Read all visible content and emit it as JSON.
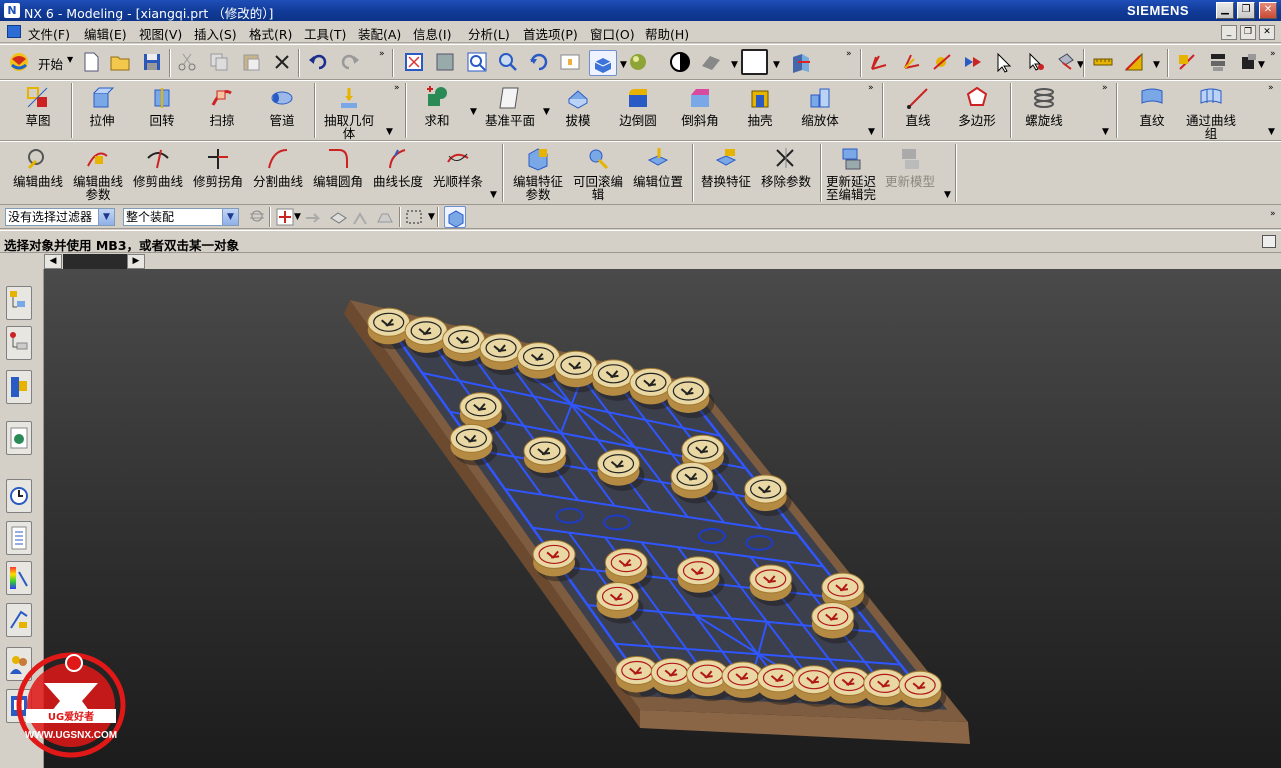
{
  "window": {
    "title": "NX 6 - Modeling - [xiangqi.prt （修改的）]",
    "brand": "SIEMENS",
    "controls": [
      "minimize",
      "maximize",
      "close"
    ]
  },
  "menu": {
    "items": [
      "文件(F)",
      "编辑(E)",
      "视图(V)",
      "插入(S)",
      "格式(R)",
      "工具(T)",
      "装配(A)",
      "信息(I)",
      "分析(L)",
      "首选项(P)",
      "窗口(O)",
      "帮助(H)"
    ]
  },
  "standard_toolbar": {
    "start_label": "开始",
    "icons": [
      "new-file-icon",
      "open-folder-icon",
      "save-icon",
      "cut-icon",
      "copy-icon",
      "paste-icon",
      "delete-icon",
      "undo-icon",
      "redo-icon",
      "fit-icon",
      "zoom-window-icon",
      "zoom-icon",
      "zoom-in-out-icon",
      "rotate-icon",
      "pan-icon",
      "shaded-view-icon",
      "render-style-icon",
      "face-analysis-icon",
      "sheet-icon",
      "background-icon",
      "orient-view-icon",
      "wcs-icon",
      "csys-icon",
      "point-icon",
      "snap-icon",
      "select-icon",
      "filter-icon",
      "measure-distance-icon",
      "measure-angle-icon",
      "assembly-icon",
      "component-icon",
      "constraint-icon"
    ]
  },
  "feature_toolbar": {
    "buttons": [
      "草图",
      "拉伸",
      "回转",
      "扫掠",
      "管道",
      "抽取几何体",
      "求和",
      "基准平面",
      "拔模",
      "边倒圆",
      "倒斜角",
      "抽壳",
      "缩放体",
      "直线",
      "多边形",
      "螺旋线",
      "直纹",
      "通过曲线组"
    ]
  },
  "edit_toolbar": {
    "buttons": [
      "编辑曲线",
      "编辑曲线参数",
      "修剪曲线",
      "修剪拐角",
      "分割曲线",
      "编辑圆角",
      "曲线长度",
      "光顺样条",
      "编辑特征参数",
      "可回滚编辑",
      "编辑位置",
      "替换特征",
      "移除参数",
      "更新延迟至编辑完",
      "更新模型"
    ],
    "disabled": [
      "更新模型"
    ]
  },
  "selection_bar": {
    "filter_value": "没有选择过滤器",
    "scope_value": "整个装配"
  },
  "status": {
    "cue_line": "选择对象并使用 MB3，或者双击某一对象"
  },
  "resource_bar": {
    "tabs": [
      "assembly-navigator-icon",
      "constraint-navigator-icon",
      "part-navigator-icon",
      "reuse-library-icon",
      "history-icon",
      "system-materials-icon",
      "palette-icon",
      "roles-icon",
      "web-browser-icon",
      "process-studio-icon"
    ]
  },
  "watermark": {
    "url_text": "WWW.UGSNX.COM",
    "logo_text": "UG爱好者"
  },
  "colors": {
    "titlebar": "#1f4fb8",
    "grid_line": "#2f56ff",
    "board_wood": "#7e5c40",
    "piece_face": "#e9d8a4",
    "viewport_bg": "#333333"
  }
}
